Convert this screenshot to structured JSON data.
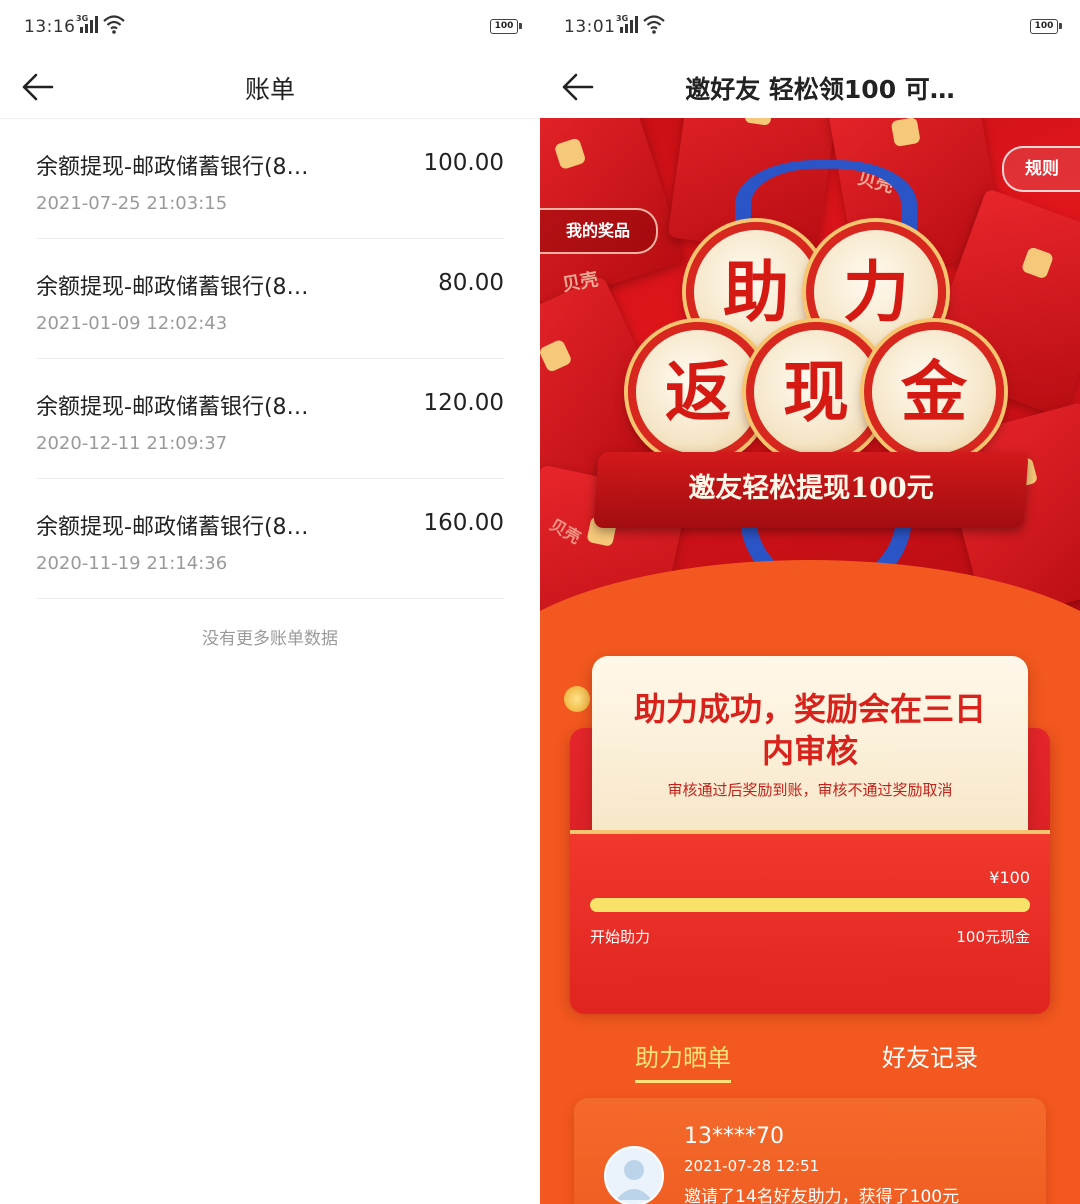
{
  "left": {
    "status": {
      "time": "13:16",
      "network": "3G",
      "battery": "100"
    },
    "nav": {
      "title": "账单"
    },
    "bills": [
      {
        "title": "余额提现-邮政储蓄银行(8…",
        "amount": "100.00",
        "date": "2021-07-25 21:03:15"
      },
      {
        "title": "余额提现-邮政储蓄银行(8…",
        "amount": "80.00",
        "date": "2021-01-09 12:02:43"
      },
      {
        "title": "余额提现-邮政储蓄银行(8…",
        "amount": "120.00",
        "date": "2020-12-11 21:09:37"
      },
      {
        "title": "余额提现-邮政储蓄银行(8…",
        "amount": "160.00",
        "date": "2020-11-19 21:14:36"
      }
    ],
    "footer": "没有更多账单数据"
  },
  "right": {
    "status": {
      "time": "13:01",
      "network": "3G",
      "battery": "100"
    },
    "nav": {
      "title": "邀好友 轻松领100 可…"
    },
    "banner": {
      "rules": "规则",
      "my_prizes": "我的奖品",
      "coins": [
        "助",
        "力",
        "返",
        "现",
        "金"
      ],
      "ribbon": "邀友轻松提现100元",
      "brand": "贝壳"
    },
    "notice": {
      "title": "助力成功，奖励会在三日内审核",
      "subtitle": "审核通过后奖励到账，审核不通过奖励取消"
    },
    "progress": {
      "reward": "¥100",
      "fraction": 1.0,
      "start_label": "开始助力",
      "end_label": "100元现金"
    },
    "tabs": [
      {
        "label": "助力晒单",
        "active": true
      },
      {
        "label": "好友记录",
        "active": false
      }
    ],
    "record": {
      "name": "13****70",
      "date": "2021-07-28 12:51",
      "text": "邀请了14名好友助力，获得了100元"
    },
    "colors": {
      "accent": "#f2581f",
      "red": "#d8231d",
      "gold": "#ffe27a"
    }
  }
}
